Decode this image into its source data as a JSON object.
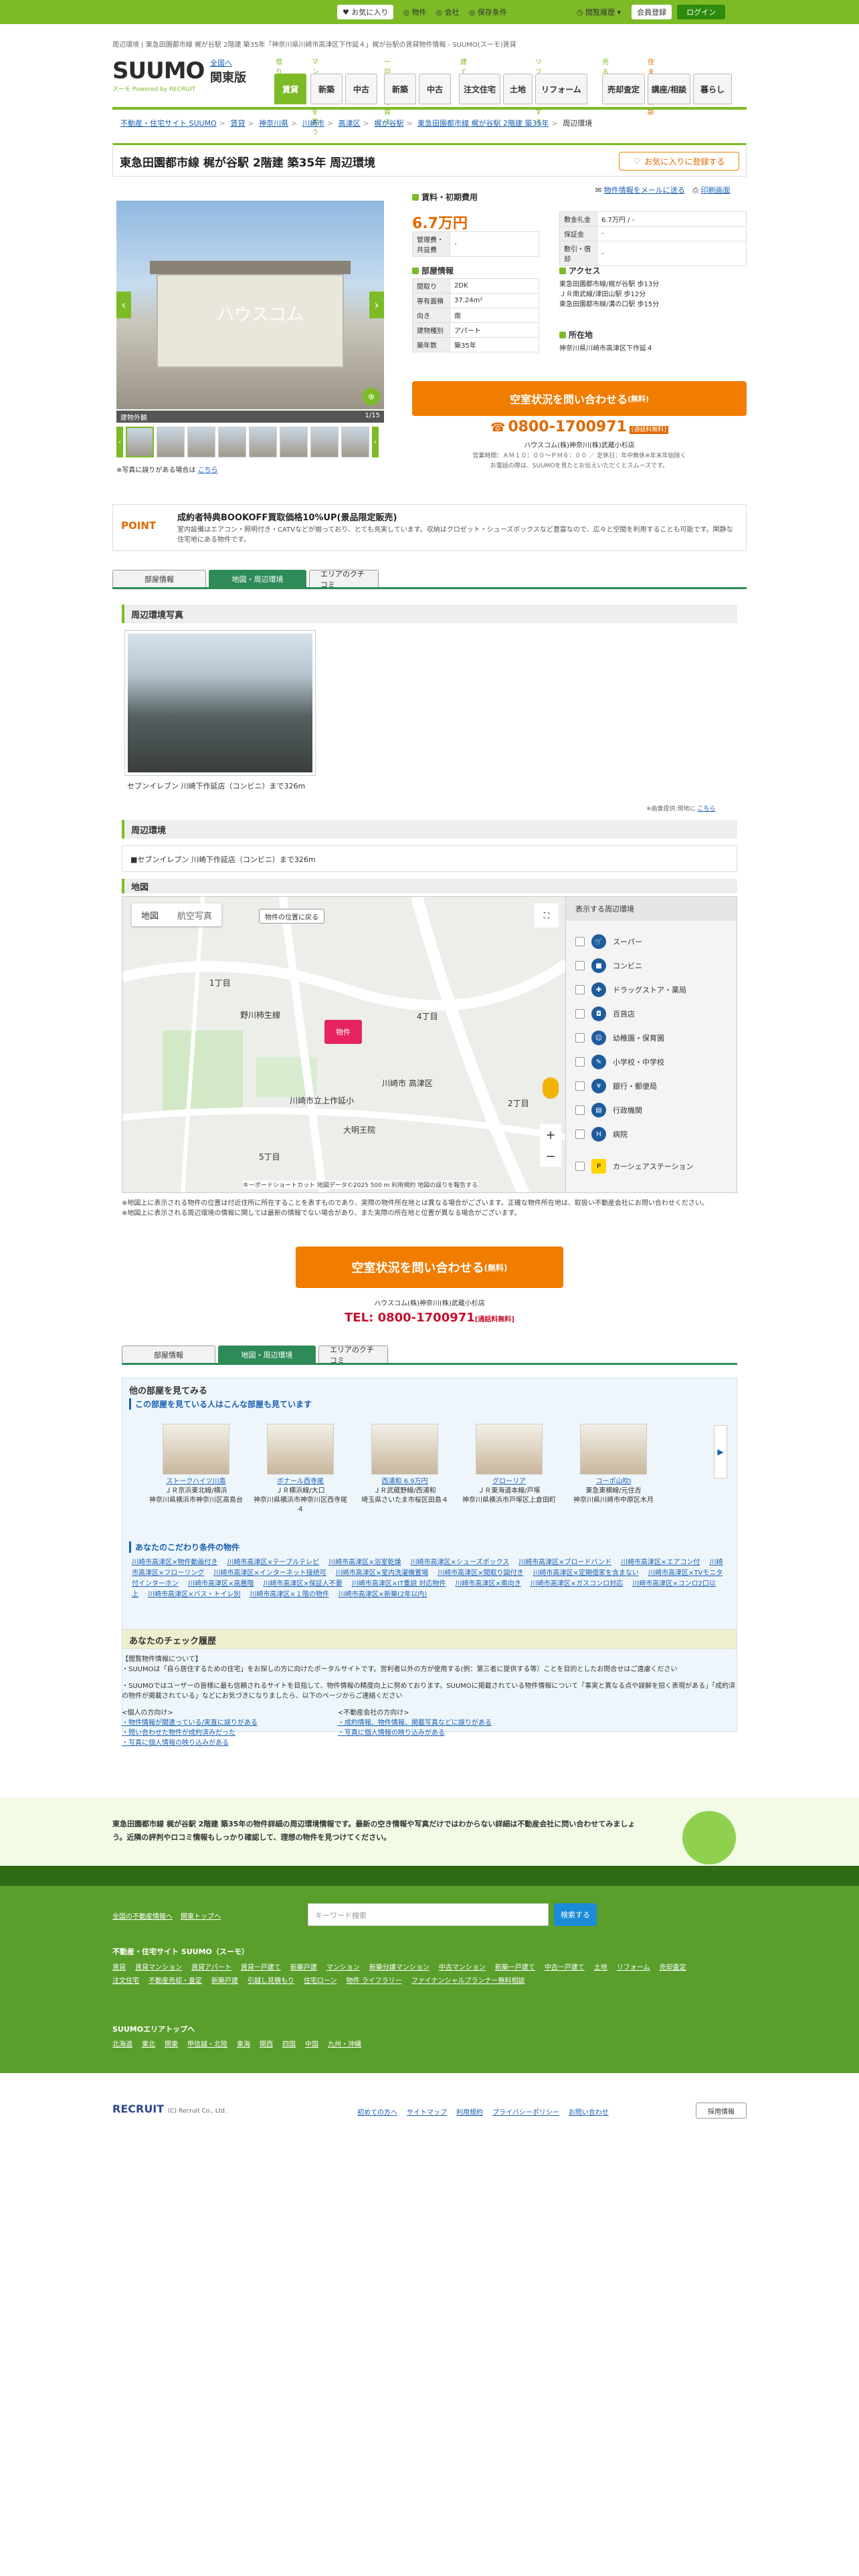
{
  "topbar": {
    "items": [
      "お気に入り",
      "物件",
      "会社",
      "保存条件",
      "閲覧履歴"
    ],
    "member_register": "会員登録",
    "login": "ログイン"
  },
  "breadcrumb_top": "周辺環境 | 東急田園都市線 梶が谷駅 2階建 築35年「神奈川県川崎市高津区下作延４」梶が谷駅の賃貸物件情報 - SUUMO(スーモ)賃貸",
  "logo": {
    "name": "SUUMO",
    "sub": "スーモ",
    "tagline": "Powered by RECRUIT"
  },
  "region": {
    "change": "全国へ",
    "name": "関東版"
  },
  "gnav": {
    "cats": [
      "借りる",
      "マンションを買う",
      "一戸建てを買う",
      "建てる",
      "リフォームする",
      "売る",
      "住まいの相談"
    ],
    "tabs": [
      "賃貸",
      "新築",
      "中古",
      "新築",
      "中古",
      "注文住宅",
      "土地",
      "リフォーム",
      "売却査定",
      "講座/相談",
      "暮らし"
    ]
  },
  "crumbs": [
    "不動産・住宅サイト SUUMO",
    "賃貸",
    "神奈川県",
    "川崎市",
    "高津区",
    "梶が谷駅",
    "東急田園都市線 梶が谷駅 2階建 築35年",
    "周辺環境"
  ],
  "title": "東急田園都市線 梶が谷駅 2階建 築35年 周辺環境",
  "fav_button": "お気に入りに登録する",
  "mail_link": "物件情報をメールに送る",
  "print_link": "印刷画面",
  "gallery": {
    "caption": "建物外観",
    "counter": "1/15",
    "watermark": "ハウスコム",
    "note": "※写真に誤りがある場合は",
    "note_link": "こちら"
  },
  "rent": {
    "heading": "賃料・初期費用",
    "amount": "6.7万円",
    "mgmt_label": "管理費・共益費",
    "mgmt": "-",
    "deposit_label": "敷金/礼金",
    "deposit": "-",
    "shiki_label": "保証金",
    "shiki": "-",
    "key_label": "敷引・償却",
    "key": "-",
    "price_label": "敷金礼金",
    "price": "6.7万円 / -"
  },
  "room": {
    "heading": "部屋情報",
    "rows": [
      [
        "間取り",
        "2DK"
      ],
      [
        "専有面積",
        "37.24m²"
      ],
      [
        "向き",
        "南"
      ],
      [
        "建物種別",
        "アパート"
      ],
      [
        "築年数",
        "築35年"
      ]
    ]
  },
  "access": {
    "heading": "アクセス",
    "lines": [
      "東急田園都市線/梶が谷駅 歩13分",
      "ＪＲ南武線/津田山駅 歩12分",
      "東急田園都市線/溝の口駅 歩15分"
    ]
  },
  "address": {
    "heading": "所在地",
    "value": "神奈川県川崎市高津区下作延４"
  },
  "cta": {
    "label": "空室状況を問い合わせる",
    "sub": "(無料)",
    "tel": "0800-1700971",
    "tel_badge": "[通話料無料]",
    "shop": "ハウスコム(株)神奈川(株)武蔵小杉店",
    "hours": "営業時間：ＡＭ１０：００〜ＰＭ６：００ ／ 定休日：年中無休※年末年始除く",
    "hint": "お電話の際は、SUUMOを見たとお伝えいただくとスムーズです。"
  },
  "point": {
    "tag": "POINT",
    "heading": "成約者特典BOOKOFF買取価格10%UP(景品限定販売)",
    "desc": "室内設備はエアコン・照明付き・CATVなどが揃っており、とても充実しています。収納はクロゼット・シューズボックスなど豊富なので、広々と空間を利用することも可能です。閑静な住宅地にある物件です。"
  },
  "tabs": [
    "部屋情報",
    "地図・周辺環境",
    "エリアのクチコミ"
  ],
  "env": {
    "photo_heading": "周辺環境写真",
    "photo_caption": "セブンイレブン 川崎下作延店（コンビニ）まで326m",
    "photo_note": "※画像提供:現地に",
    "photo_note_link": "こちら",
    "env_heading": "周辺環境",
    "env_item": "■セブンイレブン 川崎下作延店（コンビニ）まで326m"
  },
  "map": {
    "heading": "地図",
    "tab_map": "地図",
    "tab_sat": "航空写真",
    "reset": "物件の位置に戻る",
    "pin": "物件",
    "side_title": "表示する周辺環境",
    "categories": [
      "スーパー",
      "コンビニ",
      "ドラッグストア・薬局",
      "百貨店",
      "幼稚園・保育園",
      "小学校・中学校",
      "銀行・郵便局",
      "行政機関",
      "病院",
      "カーシェアステーション"
    ],
    "labels": [
      "野川柿生線",
      "川崎市 高津区",
      "4丁目",
      "1丁目",
      "2丁目",
      "5丁目",
      "大明王院",
      "川崎市立上作延小"
    ],
    "credit": "キーボードショートカット 地図データ©2025 500 m 利用規約 地図の誤りを報告する",
    "notes": [
      "※地図上に表示される物件の位置は付近住所に所在することを表すものであり、実際の物件所在地とは異なる場合がございます。正確な物件所在地は、取扱い不動産会社にお問い合わせください。",
      "※地図上に表示される周辺環境の情報に関しては最新の情報でない場合があり、また実際の所在地と位置が異なる場合がございます。"
    ]
  },
  "cta2": {
    "label": "空室状況を問い合わせる",
    "sub": "(無料)",
    "shop": "ハウスコム(株)神奈川(株)武蔵小杉店",
    "tel_label": "TEL:",
    "tel": "0800-1700971",
    "tel_badge": "[通話料無料]"
  },
  "other": {
    "heading": "他の部屋を見てみる",
    "subheading": "この部屋を見ている人はこんな部屋も見ています",
    "cards": [
      {
        "name": "ストークハイツ川島",
        "line": "ＪＲ京浜東北線/横浜",
        "addr": "神奈川県横浜市神奈川区高島台"
      },
      {
        "name": "ボナール西寺尾",
        "line": "ＪＲ横浜線/大口",
        "addr": "神奈川県横浜市神奈川区西寺尾４"
      },
      {
        "name": "西浦和 6.9万円",
        "line": "ＪＲ武蔵野線/西浦和",
        "addr": "埼玉県さいたま市桜区田島４"
      },
      {
        "name": "グローリア",
        "line": "ＪＲ東海道本線/戸塚",
        "addr": "神奈川県横浜市戸塚区上倉田町"
      },
      {
        "name": "コーポ山吹Ⅰ",
        "line": "東急東横線/元住吉",
        "addr": "神奈川県川崎市中原区木月"
      }
    ],
    "kw_heading": "あなたのこだわり条件の物件",
    "keywords": [
      "川崎市高津区×物件動画付き",
      "川崎市高津区×テーブルテレビ",
      "川崎市高津区×浴室乾燥",
      "川崎市高津区×シューズボックス",
      "川崎市高津区×ブロードバンド",
      "川崎市高津区×エアコン付",
      "川崎市高津区×フローリング",
      "川崎市高津区×インターネット接続可",
      "川崎市高津区×室内洗濯機置場",
      "川崎市高津区×間取り図付き",
      "川崎市高津区×定期借家を含まない",
      "川崎市高津区×TVモニタ付インターホン",
      "川崎市高津区×高層階",
      "川崎市高津区×保証人不要",
      "川崎市高津区×IT重説 対応物件",
      "川崎市高津区×南向き",
      "川崎市高津区×ガスコンロ対応",
      "川崎市高津区×コンロ2口以上",
      "川崎市高津区×バス・トイレ別",
      "川崎市高津区×１階の物件",
      "川崎市高津区×新築(2年以内)"
    ]
  },
  "history": {
    "heading": "あなたのチェック履歴"
  },
  "notes": [
    "【閲覧物件情報について】",
    "・SUUMOは「自ら居住するための住宅」をお探しの方に向けたポータルサイトです。営利者以外の方が使用する(例：第三者に提供する等）ことを目的としたお問合せはご遠慮ください",
    "・SUUMOではユーザーの皆様に最も信頼されるサイトを目指して、物件情報の精度向上に努めております。SUUMOに掲載されている物件情報について「事実と異なる点や誤解を招く表現がある」「成約済の物件が掲載されている」などにお気づきになりましたら、以下のページからご連絡ください",
    "<個人の方向け>",
    "・物件情報が間違っている/実直に誤りがある",
    "・問い合わせた物件が成約済みだった",
    "・写真に個人情報の映り込みがある",
    "<不動産会社の方向け>",
    "・成約情報、物件情報、掲載写真などに誤りがある",
    "・写真に個人情報の映り込みがある"
  ],
  "summary": "東急田園都市線 梶が谷駅 2階建 築35年の物件詳細の周辺環境情報です。最新の空き情報や写真だけではわからない詳細は不動産会社に問い合わせてみましょう。近隣の評判やロコミ情報もしっかり確認して、理想の物件を見つけてください。",
  "footer": {
    "links1": [
      "全国の不動産情報へ",
      "関東トップへ"
    ],
    "search_placeholder": "キーワード検索",
    "search_btn": "検索する",
    "site_heading": "不動産・住宅サイト SUUMO（スーモ）",
    "links2": [
      "賃貸",
      "賃貸マンション",
      "賃貸アパート",
      "賃貸一戸建て",
      "新築戸建",
      "マンション",
      "新築分譲マンション",
      "中古マンション",
      "新築一戸建て",
      "中古一戸建て",
      "土地",
      "リフォーム",
      "売却査定",
      "注文住宅",
      "不動産売却・査定",
      "新築戸建",
      "引越し見積もり",
      "住宅ローン",
      "物件 ライフラリー",
      "ファイナンシャルプランナー無料相談"
    ],
    "area_heading": "SUUMOエリアトップへ",
    "areas": [
      "北海道",
      "東北",
      "関東",
      "甲信越・北陸",
      "東海",
      "関西",
      "四国",
      "中国",
      "九州・沖縄"
    ]
  },
  "bottom": {
    "company": "RECRUIT",
    "copyright": "(C) Recruit Co., Ltd.",
    "links": [
      "初めての方へ",
      "サイトマップ",
      "利用規約",
      "プライバシーポリシー",
      "お問い合わせ"
    ],
    "recruit_btn": "採用情報"
  },
  "colors": {
    "brand": "#7cbb26",
    "accent": "#f07c00",
    "link": "#1a5fb4"
  }
}
